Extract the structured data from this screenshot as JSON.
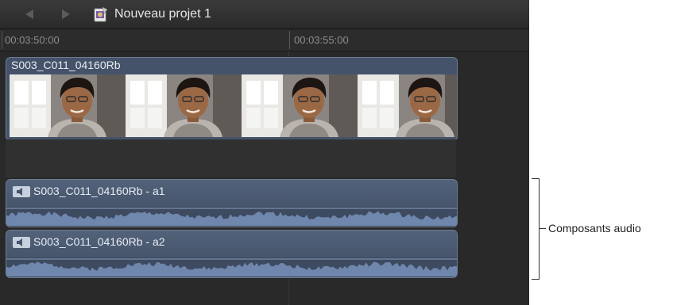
{
  "window": {
    "project_title": "Nouveau projet 1",
    "icons": [
      "back-arrow-icon",
      "forward-arrow-icon",
      "project-icon"
    ]
  },
  "ruler": {
    "timecodes": [
      "00:03:50:00",
      "00:03:55:00"
    ]
  },
  "video_clip": {
    "name": "S003_C011_04160Rb",
    "frame_count": 4
  },
  "audio_components": [
    {
      "name": "S003_C011_04160Rb - a1",
      "icon": "speaker-icon"
    },
    {
      "name": "S003_C011_04160Rb - a2",
      "icon": "speaker-icon"
    }
  ],
  "callout": {
    "label": "Composants audio"
  },
  "colors": {
    "timeline_bg": "#262626",
    "clip_blue": "#45536a",
    "clip_border": "#6d7c92",
    "waveform": "#6f86ad"
  }
}
